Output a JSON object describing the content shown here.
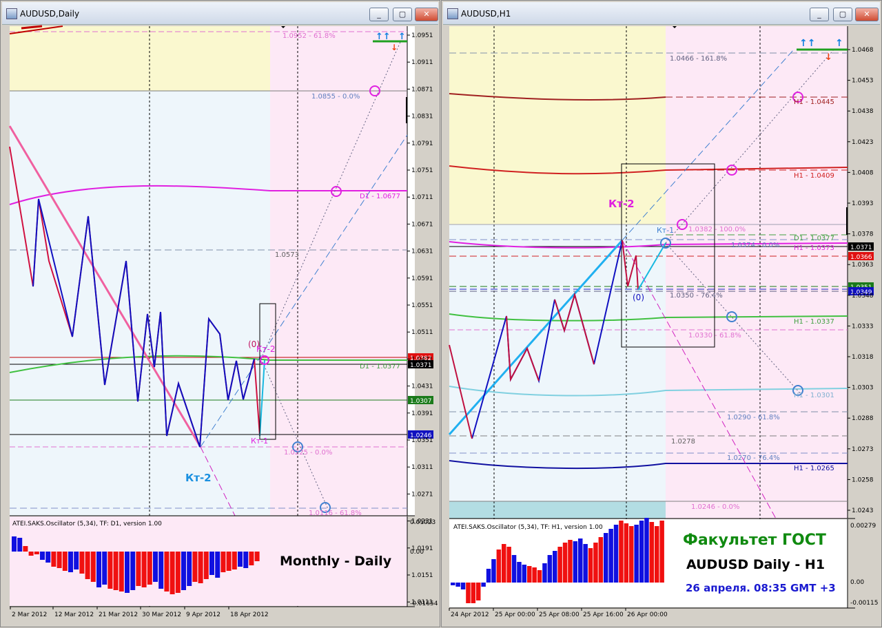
{
  "left_window": {
    "title": "AUDUSD,Daily",
    "buttons": {
      "minimize": "_",
      "restore": "▢",
      "close": "✕"
    },
    "price_labels": [
      "1.0951",
      "1.0911",
      "1.0871",
      "1.0831",
      "1.0791",
      "1.0751",
      "1.0711",
      "1.0671",
      "1.0631",
      "1.0591",
      "1.0551",
      "1.0511",
      "1.0471",
      "1.0431",
      "1.0391",
      "1.0351",
      "1.0311",
      "1.0271",
      "1.0231",
      "1.0191",
      "1.0151",
      "1.0111"
    ],
    "price_flags": [
      {
        "text": "1.0382",
        "color": "#e01010"
      },
      {
        "text": "1.0371",
        "color": "#000000"
      },
      {
        "text": "1.0307",
        "color": "#1a7a1a"
      },
      {
        "text": "1.0246",
        "color": "#1010c0"
      }
    ],
    "annotations": {
      "fib_top": "1.0952 - 61.8%",
      "fib_0855": "1.0855 - 0.0%",
      "d1_1": "D1 - 1.0677",
      "level_0573": "1.0573",
      "d1_2": "D1 - 1.0377",
      "zero": "(0)",
      "kt2_pink": "Кт-2",
      "kt1_pink": "Кт-1",
      "fib_0225": "1.0225 - 0.0%",
      "kt2_blue": "Кт-2",
      "fib_0116": "1.0116 - 61.8%"
    },
    "oscillator": {
      "label": "ATEI.SAKS.Oscillator (5,34), TF: D1, version 1.00",
      "scale": [
        "0.01023",
        "0.00",
        "-0.01654"
      ],
      "caption": "Monthly - Daily"
    },
    "dates": [
      "2 Mar 2012",
      "12 Mar 2012",
      "21 Mar 2012",
      "30 Mar 2012",
      "9 Apr 2012",
      "18 Apr 2012"
    ]
  },
  "right_window": {
    "title": "AUDUSD,H1",
    "buttons": {
      "minimize": "_",
      "restore": "▢",
      "close": "✕"
    },
    "price_labels": [
      "1.0468",
      "1.0453",
      "1.0438",
      "1.0423",
      "1.0408",
      "1.0393",
      "1.0378",
      "1.0363",
      "1.0348",
      "1.0333",
      "1.0318",
      "1.0303",
      "1.0288",
      "1.0273",
      "1.0258",
      "1.0243"
    ],
    "price_flags": [
      {
        "text": "1.0371",
        "color": "#000000"
      },
      {
        "text": "1.0366",
        "color": "#e01010"
      },
      {
        "text": "1.0351",
        "color": "#1a7a1a"
      },
      {
        "text": "1.0349",
        "color": "#1010c0"
      }
    ],
    "annotations": {
      "fib_top": "1.0466 - 161.8%",
      "h1_0445": "H1 - 1.0445",
      "h1_0409": "H1 - 1.0409",
      "kt2": "Кт-2",
      "kt1": "Кт-1",
      "fib_0382": "1.0382 - 100.0%",
      "d1_0377": "D1 - 1.0377",
      "fib_0374": "1.0374 - 0.0%",
      "h1_0373": "H1 - 1.0373",
      "zero": "(0)",
      "fib_0350": "1.0350 - 76.4%",
      "h1_0337": "H1 - 1.0337",
      "fib_0330": "1.0330 - 61.8%",
      "h1_0301": "H1 - 1.0301",
      "fib_0290": "1.0290 - 61.8%",
      "level_0278": "1.0278",
      "fib_0270": "1.0270 - 76.4%",
      "h1_0265": "H1 - 1.0265",
      "fib_0246": "1.0246 - 0.0%"
    },
    "oscillator": {
      "label": "ATEI.SAKS.Oscillator (5,34), TF: H1, version 1.00",
      "scale": [
        "0.00279",
        "0.00",
        "-0.00115"
      ]
    },
    "captions": {
      "line1": "Факультет ГОСТ",
      "line2": "AUDUSD Daily - H1",
      "line3": "26 апреля. 08:35 GMT +3"
    },
    "dates": [
      "24 Apr 2012",
      "25 Apr 00:00",
      "25 Apr 08:00",
      "25 Apr 16:00",
      "26 Apr 00:00"
    ]
  },
  "colors": {
    "pink_zone": "#fde9f6",
    "yellow_zone": "#faf8cf",
    "blue_zone": "#eef6fb",
    "teal_zone": "#b3dde3",
    "bull": "#1010c8",
    "bear": "#e01010",
    "magenta": "#e020e0",
    "caption_green": "#108a10",
    "caption_blue": "#1a1ad0"
  }
}
